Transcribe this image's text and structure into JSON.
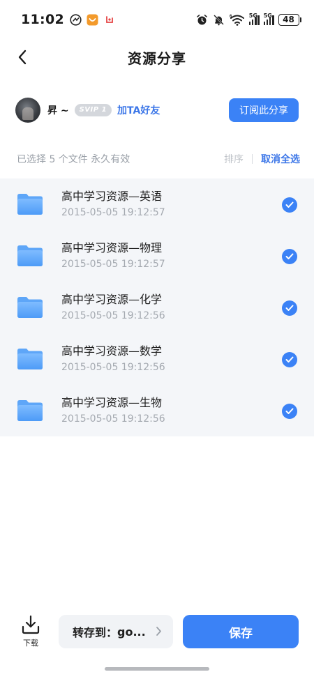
{
  "status_bar": {
    "time": "11:02",
    "battery": "48",
    "network_label_1": "5G",
    "network_label_2": "5G",
    "wifi_label": "6",
    "left_icons": [
      "messenger-app-icon",
      "shopping-app-icon",
      "red-app-icon"
    ],
    "right_icons": [
      "alarm-icon",
      "mute-icon",
      "wifi-icon",
      "signal-icon",
      "signal-icon",
      "battery-icon"
    ]
  },
  "header": {
    "title": "资源分享",
    "back_icon": "chevron-left-icon"
  },
  "sharer": {
    "name": "昇 ~",
    "badge": "SVIP 1",
    "add_friend": "加TA好友",
    "subscribe": "订阅此分享"
  },
  "selection": {
    "info": "已选择 5 个文件  永久有效",
    "sort": "排序",
    "cancel_all": "取消全选"
  },
  "files": [
    {
      "name": "高中学习资源—英语",
      "date": "2015-05-05  19:12:57",
      "checked": true
    },
    {
      "name": "高中学习资源—物理",
      "date": "2015-05-05  19:12:57",
      "checked": true
    },
    {
      "name": "高中学习资源—化学",
      "date": "2015-05-05  19:12:56",
      "checked": true
    },
    {
      "name": "高中学习资源—数学",
      "date": "2015-05-05  19:12:56",
      "checked": true
    },
    {
      "name": "高中学习资源—生物",
      "date": "2015-05-05  19:12:56",
      "checked": true
    }
  ],
  "bottom": {
    "download_label": "下载",
    "save_to_label": "转存到：",
    "save_to_dest": "go...",
    "save_button": "保存"
  },
  "colors": {
    "accent": "#3b82f6",
    "link": "#3d77e8",
    "list_bg": "#f4f6f9",
    "muted_text": "#a4a9b0"
  }
}
